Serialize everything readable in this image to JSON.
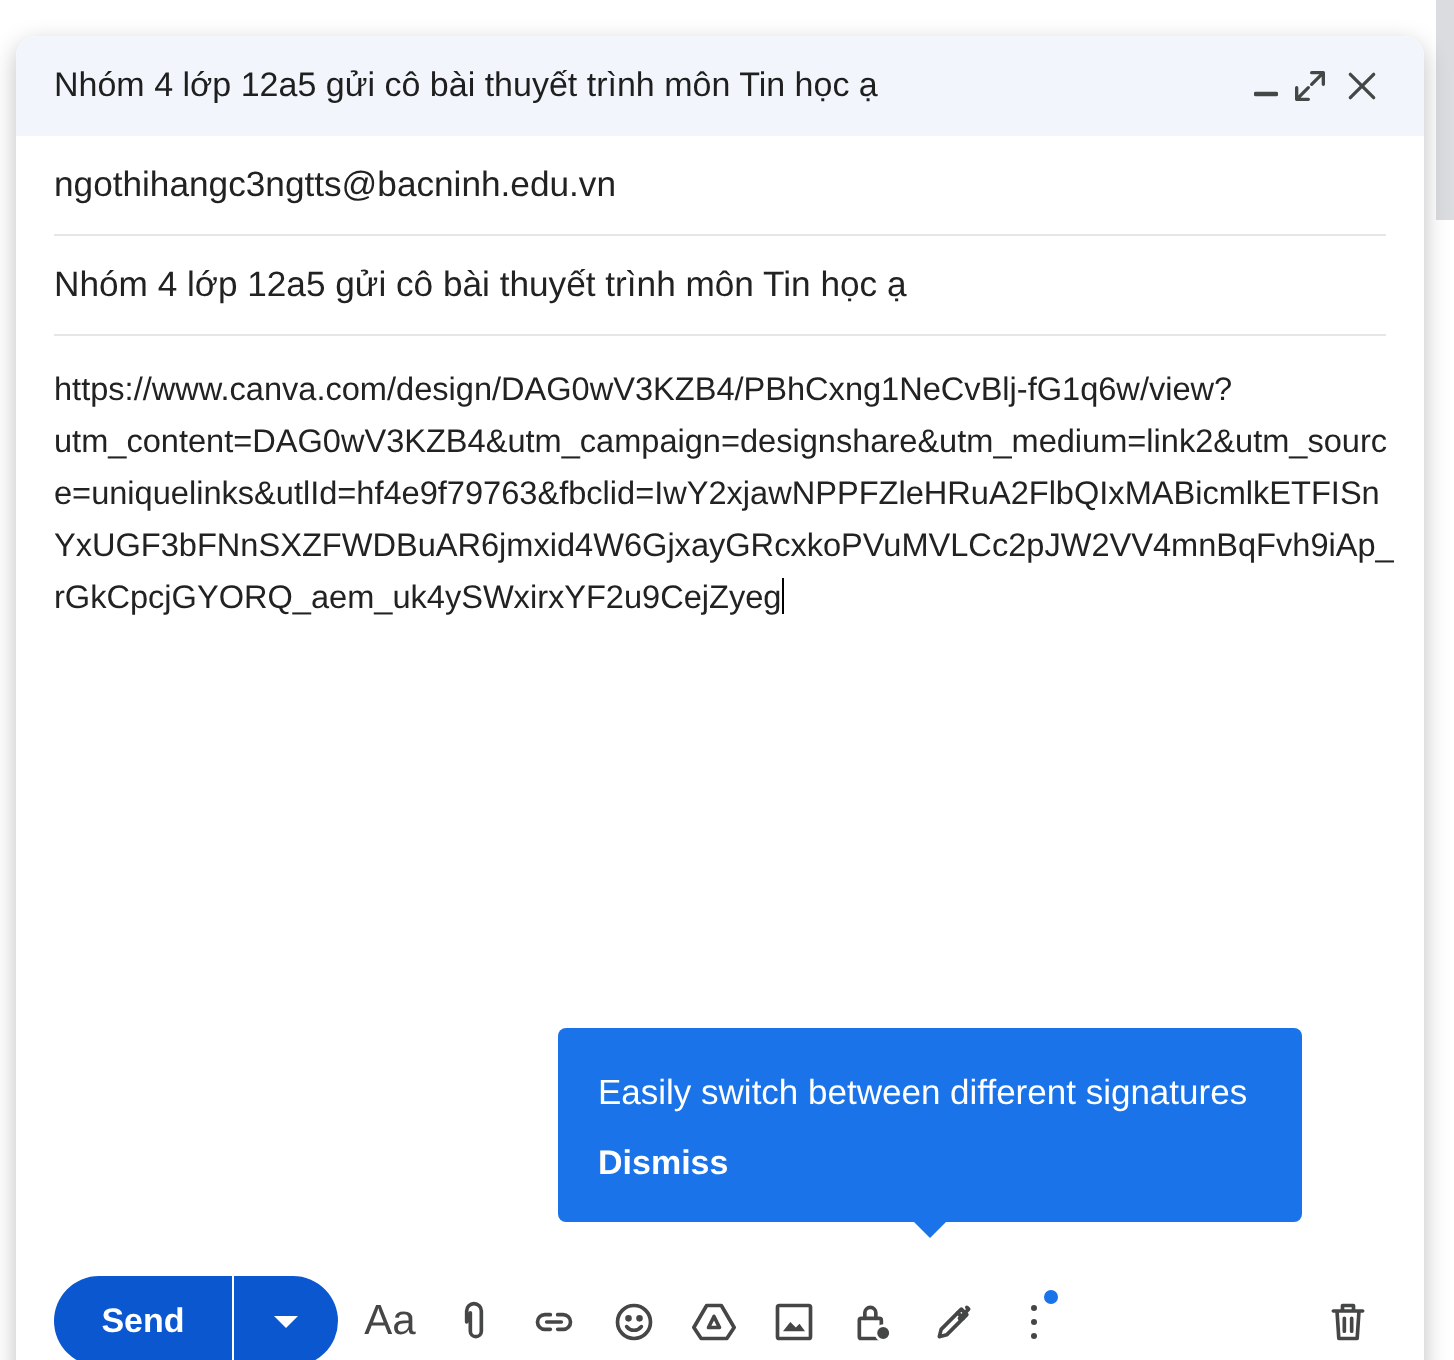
{
  "compose": {
    "title": "Nhóm 4 lớp 12a5 gửi cô bài thuyết trình môn Tin học ạ",
    "recipients": "ngothihangc3ngtts@bacninh.edu.vn",
    "subject": "Nhóm 4 lớp 12a5 gửi cô bài thuyết trình môn Tin học ạ",
    "body": "https://www.canva.com/design/DAG0wV3KZB4/PBhCxng1NeCvBlj-fG1q6w/view?utm_content=DAG0wV3KZB4&utm_campaign=designshare&utm_medium=link2&utm_source=uniquelinks&utlId=hf4e9f79763&fbclid=IwY2xjawNPPFZleHRuA2FlbQIxMABicmlkETFISnYxUGF3bFNnSXZFWDBuAR6jmxid4W6GjxayGRcxkoPVuMVLCc2pJW2VV4mnBqFvh9iAp_rGkCpcjGYORQ_aem_uk4ySWxirxYF2u9CejZyeg"
  },
  "tooltip": {
    "text": "Easily switch between different signatures",
    "action": "Dismiss"
  },
  "toolbar": {
    "send": "Send",
    "format": "Aa",
    "tools": [
      {
        "kind": "attach"
      },
      {
        "kind": "link"
      },
      {
        "kind": "emoji"
      },
      {
        "kind": "drive"
      },
      {
        "kind": "photo"
      },
      {
        "kind": "confidential"
      },
      {
        "kind": "signature"
      },
      {
        "kind": "more",
        "new": true
      }
    ]
  }
}
